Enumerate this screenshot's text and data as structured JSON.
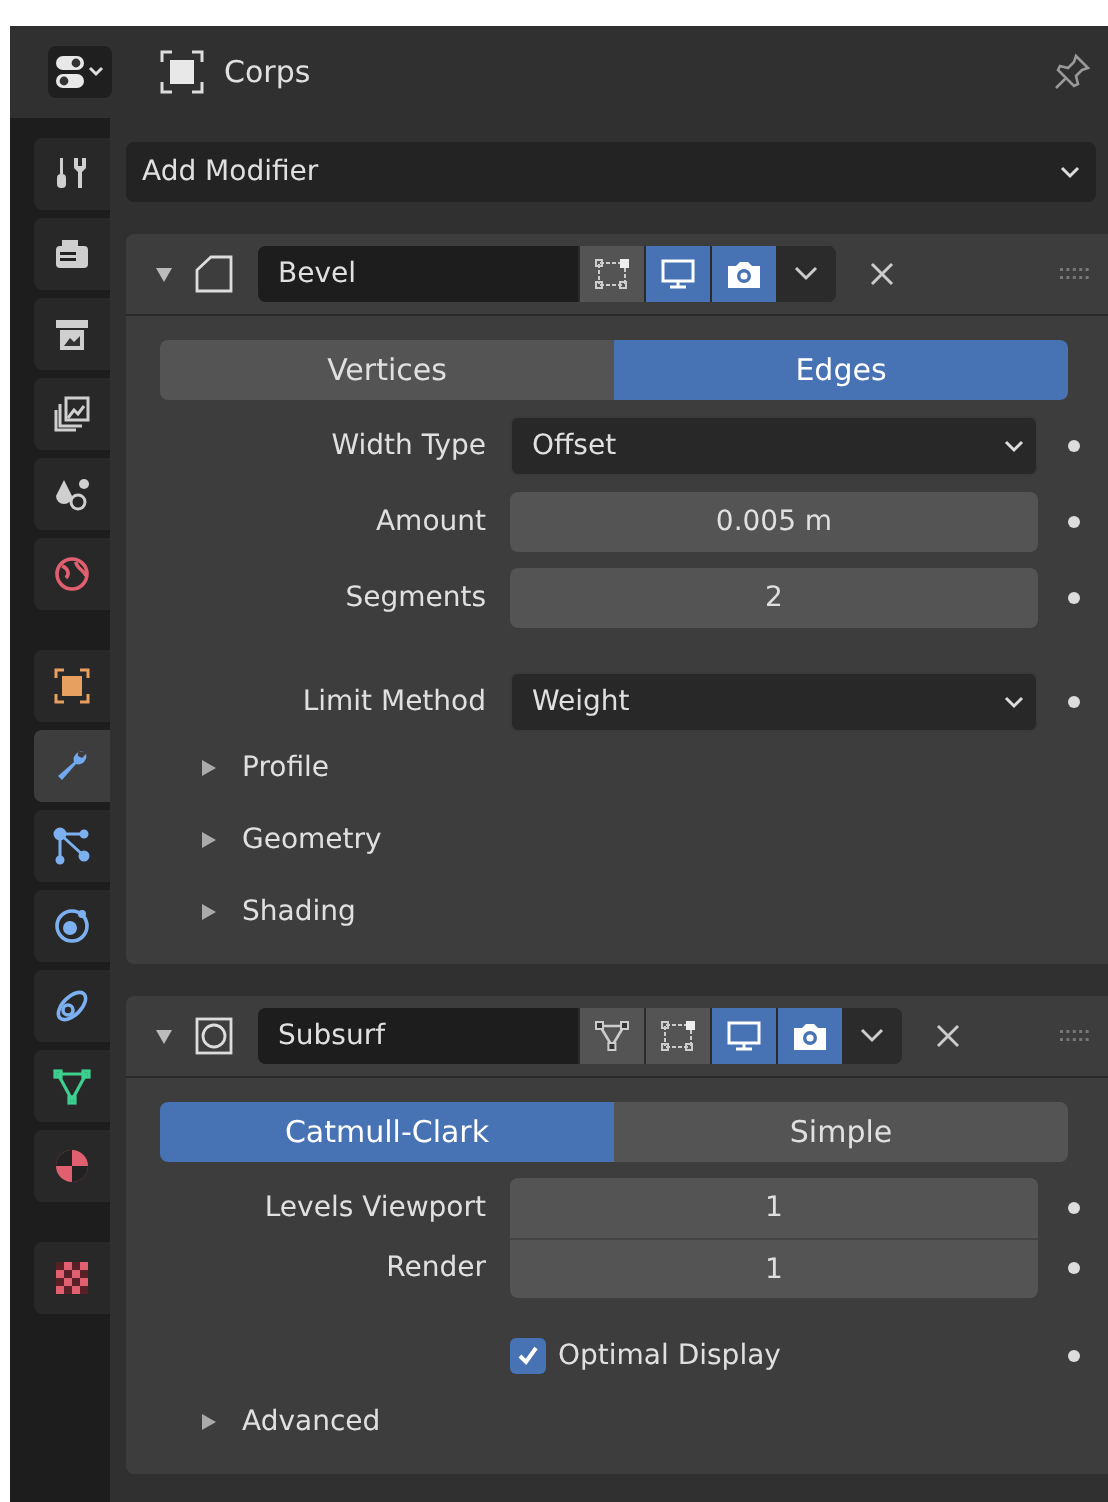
{
  "header": {
    "object_name": "Corps"
  },
  "sidebar": {
    "tabs": [
      {
        "selected": false
      },
      {
        "selected": false
      },
      {
        "selected": false
      },
      {
        "selected": false
      },
      {
        "selected": false
      },
      {
        "selected": false
      },
      {
        "selected": false
      },
      {
        "selected": true
      },
      {
        "selected": false
      },
      {
        "selected": false
      },
      {
        "selected": false
      },
      {
        "selected": false
      },
      {
        "selected": false
      },
      {
        "selected": false
      }
    ]
  },
  "add_modifier": {
    "label": "Add Modifier"
  },
  "modifiers": [
    {
      "kind": "bevel",
      "name": "Bevel",
      "expanded": true,
      "toggles": [
        {
          "kind": "editmode",
          "on": false
        },
        {
          "kind": "viewport",
          "on": true
        },
        {
          "kind": "render",
          "on": true
        }
      ],
      "modes": [
        {
          "label": "Vertices",
          "selected": false
        },
        {
          "label": "Edges",
          "selected": true
        }
      ],
      "fields": [
        {
          "kind": "menu",
          "label": "Width Type",
          "value": "Offset"
        },
        {
          "kind": "number",
          "label": "Amount",
          "value": "0.005 m"
        },
        {
          "kind": "number",
          "label": "Segments",
          "value": "2"
        },
        {
          "kind": "menu",
          "label": "Limit Method",
          "value": "Weight",
          "spaced": true
        }
      ],
      "subpanels": [
        {
          "label": "Profile",
          "expanded": false
        },
        {
          "label": "Geometry",
          "expanded": false
        },
        {
          "label": "Shading",
          "expanded": false
        }
      ]
    },
    {
      "kind": "subsurf",
      "name": "Subsurf",
      "expanded": true,
      "toggles": [
        {
          "kind": "cage",
          "on": false
        },
        {
          "kind": "editmode",
          "on": false
        },
        {
          "kind": "viewport",
          "on": true
        },
        {
          "kind": "render",
          "on": true
        }
      ],
      "modes": [
        {
          "label": "Catmull-Clark",
          "selected": true
        },
        {
          "label": "Simple",
          "selected": false
        }
      ],
      "fields": [
        {
          "kind": "number",
          "label": "Levels Viewport",
          "value": "1"
        },
        {
          "kind": "number",
          "label": "Render",
          "value": "1",
          "joined": true
        },
        {
          "kind": "checkbox",
          "label": "Optimal Display",
          "checked": true
        }
      ],
      "subpanels": [
        {
          "label": "Advanced",
          "expanded": false
        }
      ]
    }
  ]
}
